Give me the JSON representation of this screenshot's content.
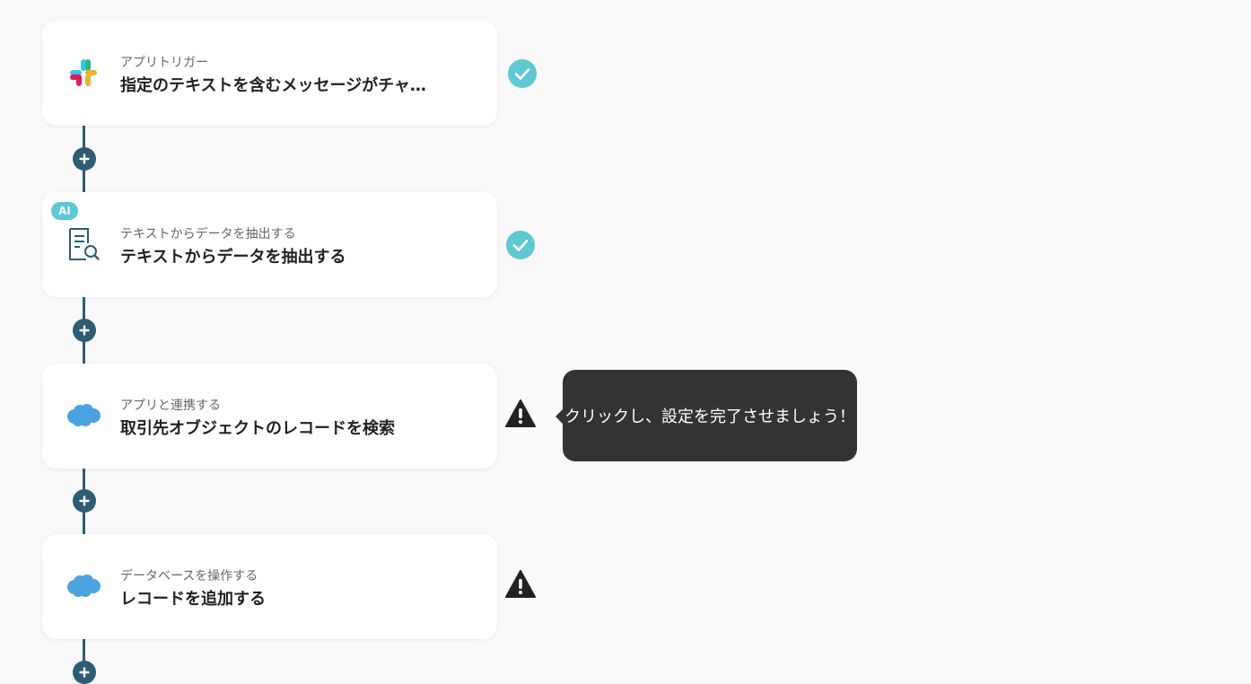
{
  "steps": [
    {
      "subtitle": "アプリトリガー",
      "title": "指定のテキストを含むメッセージがチャンネルに投稿されたら",
      "icon": "slack-icon",
      "status": "complete",
      "badge": ""
    },
    {
      "subtitle": "テキストからデータを抽出する",
      "title": "テキストからデータを抽出する",
      "icon": "document-search-icon",
      "status": "complete",
      "badge": "AI"
    },
    {
      "subtitle": "アプリと連携する",
      "title": "取引先オブジェクトのレコードを検索",
      "icon": "salesforce-icon",
      "status": "warning",
      "badge": ""
    },
    {
      "subtitle": "データベースを操作する",
      "title": "レコードを追加する",
      "icon": "salesforce-icon",
      "status": "warning",
      "badge": ""
    }
  ],
  "tooltip": "クリックし、設定を完了させましょう！",
  "colors": {
    "line": "#2e5c72",
    "check": "#5ec8d4",
    "warning": "#222222",
    "salesforce": "#4aa3df"
  }
}
